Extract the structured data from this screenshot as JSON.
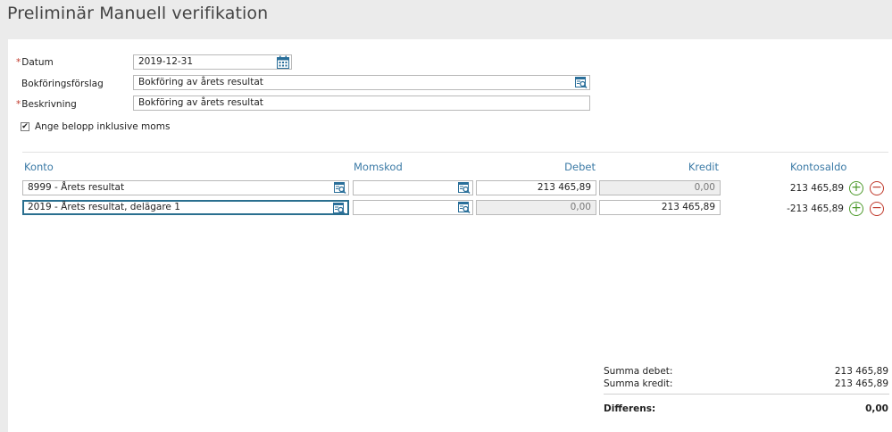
{
  "page": {
    "title": "Preliminär Manuell verifikation"
  },
  "form": {
    "required_mark": "*",
    "datum_label": "Datum",
    "datum_value": "2019-12-31",
    "bokforingsforslag_label": "Bokföringsförslag",
    "bokforingsforslag_value": "Bokföring av årets resultat",
    "beskrivning_label": "Beskrivning",
    "beskrivning_value": "Bokföring av årets resultat",
    "moms_checkbox_label": "Ange belopp inklusive moms",
    "moms_checkbox_checked": true
  },
  "table": {
    "headers": {
      "konto": "Konto",
      "momskod": "Momskod",
      "debet": "Debet",
      "kredit": "Kredit",
      "kontosaldo": "Kontosaldo"
    },
    "rows": [
      {
        "konto": "8999 - Årets resultat",
        "momskod": "",
        "debet": "213 465,89",
        "kredit": "0,00",
        "kontosaldo": "213 465,89"
      },
      {
        "konto": "2019 - Årets resultat, delägare 1",
        "momskod": "",
        "debet": "0,00",
        "kredit": "213 465,89",
        "kontosaldo": "-213 465,89"
      }
    ]
  },
  "summary": {
    "summa_debet_label": "Summa debet:",
    "summa_debet_value": "213 465,89",
    "summa_kredit_label": "Summa kredit:",
    "summa_kredit_value": "213 465,89",
    "differens_label": "Differens:",
    "differens_value": "0,00"
  },
  "icons": {
    "calendar": "calendar-icon",
    "lookup": "lookup-icon",
    "add": "add-row-icon",
    "remove": "remove-row-icon"
  },
  "colors": {
    "header_blue": "#3b7aa6",
    "required_red": "#c0392b",
    "add_green": "#4e9a2c",
    "remove_red": "#c0392b"
  }
}
